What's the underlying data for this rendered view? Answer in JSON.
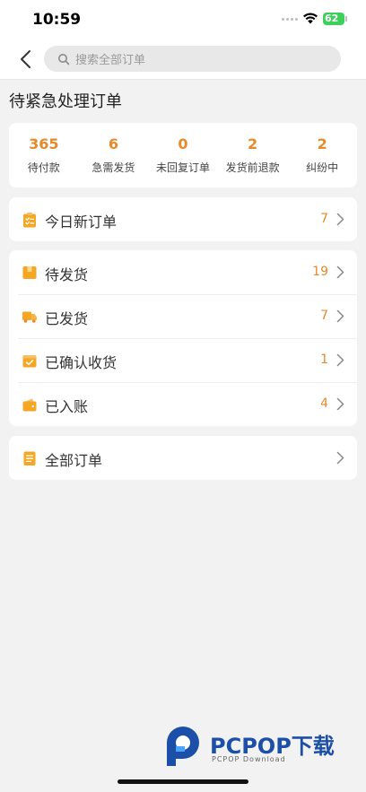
{
  "status_bar": {
    "time": "10:59",
    "battery": "62"
  },
  "nav": {
    "search_placeholder": "搜索全部订单"
  },
  "section": {
    "title": "待紧急处理订单"
  },
  "stats": [
    {
      "value": "365",
      "label": "待付款"
    },
    {
      "value": "6",
      "label": "急需发货"
    },
    {
      "value": "0",
      "label": "未回复订单"
    },
    {
      "value": "2",
      "label": "发货前退款"
    },
    {
      "value": "2",
      "label": "纠纷中"
    }
  ],
  "today": {
    "label": "今日新订单",
    "count": "7",
    "icon": "clipboard-list-icon"
  },
  "orders": [
    {
      "label": "待发货",
      "count": "19",
      "icon": "package-icon"
    },
    {
      "label": "已发货",
      "count": "7",
      "icon": "truck-icon"
    },
    {
      "label": "已确认收货",
      "count": "1",
      "icon": "check-box-icon"
    },
    {
      "label": "已入账",
      "count": "4",
      "icon": "wallet-icon"
    }
  ],
  "all_orders": {
    "label": "全部订单",
    "icon": "document-icon"
  },
  "watermark": {
    "brand": "PCPOP下载",
    "sub": "PCPOP Download"
  },
  "colors": {
    "accent": "#e8892a",
    "icon": "#f5a623",
    "background": "#f2f2f2",
    "watermark": "#1c4fa8"
  }
}
